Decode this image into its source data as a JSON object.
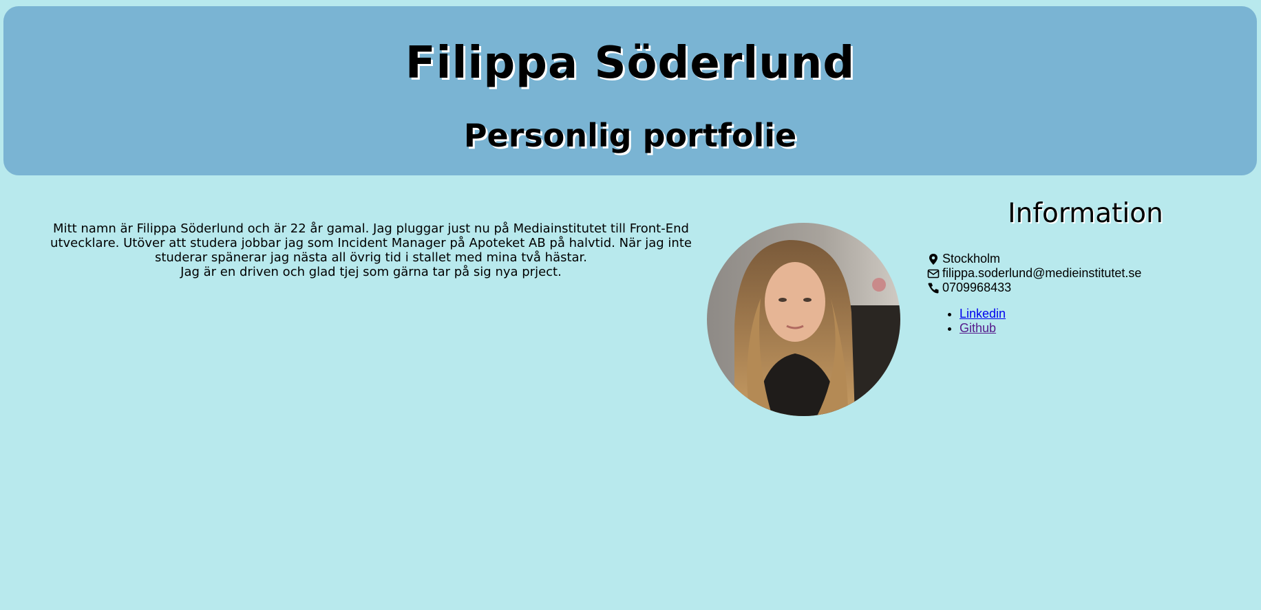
{
  "header": {
    "title": "Filippa Söderlund",
    "subtitle": "Personlig portfolie"
  },
  "bio": {
    "paragraph1": "Mitt namn är Filippa Söderlund och är 22 år gamal. Jag pluggar just nu på Mediainstitutet till Front-End utvecklare. Utöver att studera jobbar jag som Incident Manager på Apoteket AB på halvtid. När jag inte studerar spänerar jag nästa all övrig tid i stallet med mina två hästar.",
    "paragraph2": "Jag är en driven och glad tjej som gärna tar på sig nya prject."
  },
  "info": {
    "heading": "Information",
    "location": "Stockholm",
    "email": "filippa.soderlund@medieinstitutet.se",
    "phone": "0709968433",
    "links": [
      "Linkedin",
      "Github"
    ]
  },
  "colors": {
    "background": "#b8e9ed",
    "header": "#7ab4d3",
    "link": "#0000ee",
    "visited_link": "#551a8b"
  }
}
